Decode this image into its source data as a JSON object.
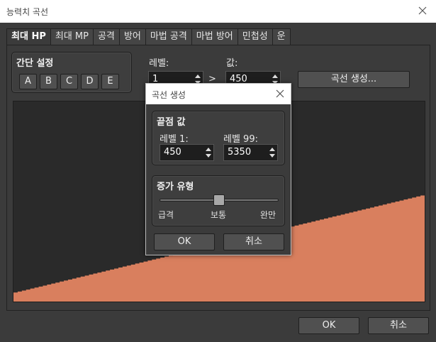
{
  "window": {
    "title": "능력치 곡선"
  },
  "tabs": [
    {
      "label": "최대 HP",
      "active": true
    },
    {
      "label": "최대 MP"
    },
    {
      "label": "공격"
    },
    {
      "label": "방어"
    },
    {
      "label": "마법 공격"
    },
    {
      "label": "마법 방어"
    },
    {
      "label": "민첩성"
    },
    {
      "label": "운"
    }
  ],
  "quick_settings": {
    "title": "간단 설정",
    "presets": [
      "A",
      "B",
      "C",
      "D",
      "E"
    ]
  },
  "level_field": {
    "label": "레벨:",
    "value": "1"
  },
  "arrow": ">",
  "value_field": {
    "label": "값:",
    "value": "450"
  },
  "generate_button": "곡선 생성...",
  "chart_data": {
    "type": "area",
    "x": [
      1,
      99
    ],
    "y": [
      450,
      5350
    ],
    "xlim": [
      1,
      99
    ],
    "ylim": [
      0,
      9999
    ],
    "color": "#d97f5e",
    "background": "#2a2a2a"
  },
  "dialog": {
    "title": "곡선 생성",
    "endpoints": {
      "title": "끝점 값",
      "level1": {
        "label": "레벨 1:",
        "value": "450"
      },
      "level99": {
        "label": "레벨 99:",
        "value": "5350"
      }
    },
    "growth": {
      "title": "증가 유형",
      "slider_value": 0.5,
      "labels": {
        "left": "급격",
        "middle": "보통",
        "right": "완만"
      }
    },
    "ok": "OK",
    "cancel": "취소"
  },
  "footer": {
    "ok": "OK",
    "cancel": "취소"
  }
}
